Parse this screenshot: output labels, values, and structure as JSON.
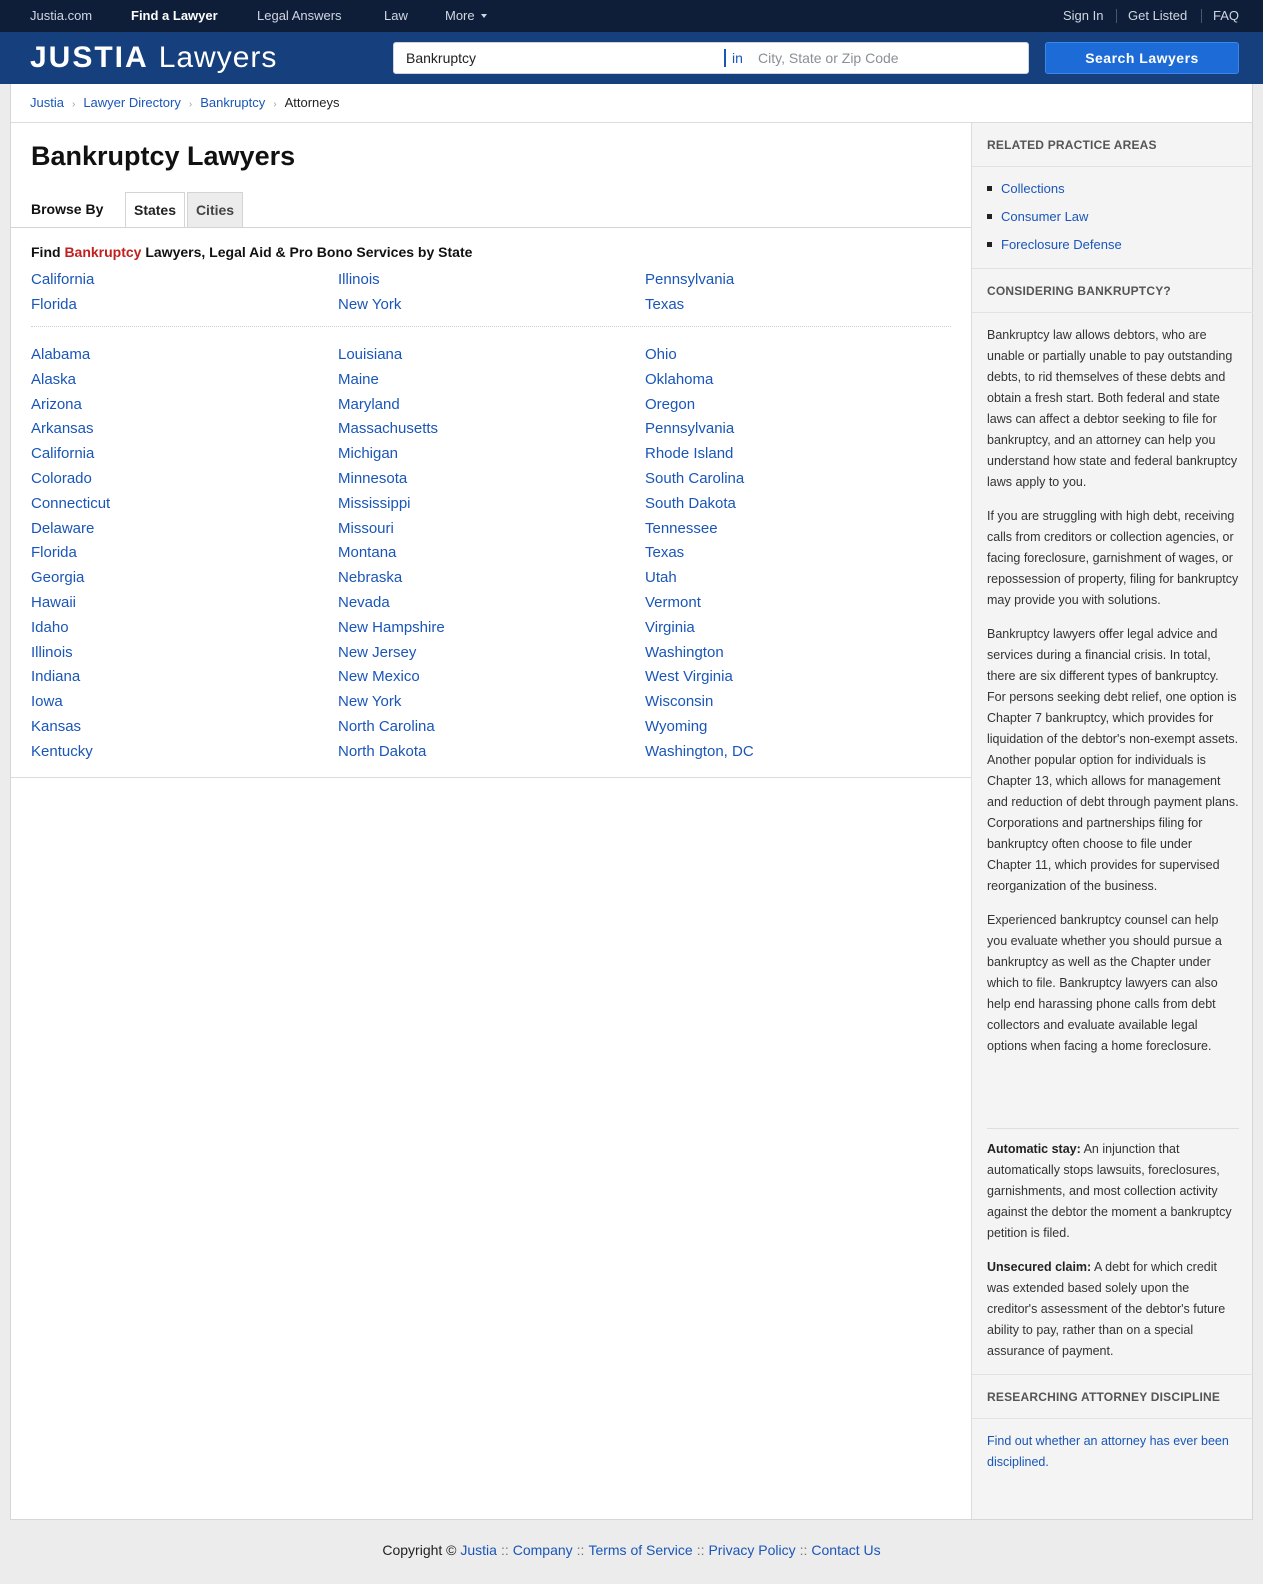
{
  "topnav": {
    "left": [
      {
        "label": "Justia.com"
      },
      {
        "label": "Find a Lawyer"
      },
      {
        "label": "Legal Answers"
      },
      {
        "label": "Law"
      },
      {
        "label": "More"
      }
    ],
    "right": [
      {
        "label": "Sign In"
      },
      {
        "label": "Get Listed"
      },
      {
        "label": "FAQ"
      }
    ]
  },
  "header": {
    "logo_strong": "JUSTIA",
    "logo_light": "Lawyers",
    "search_value": "Bankruptcy",
    "in_label": "in",
    "location_placeholder": "City, State or Zip Code",
    "search_button": "Search Lawyers"
  },
  "breadcrumb": {
    "items": [
      "Justia",
      "Lawyer Directory",
      "Bankruptcy"
    ],
    "current": "Attorneys"
  },
  "main": {
    "title": "Bankruptcy Lawyers",
    "browse_label": "Browse By",
    "tabs": [
      "States",
      "Cities"
    ],
    "find_prefix": "Find",
    "find_highlight": "Bankruptcy",
    "find_suffix": "Lawyers, Legal Aid & Pro Bono Services by State",
    "popular_states": [
      [
        "California",
        "Florida"
      ],
      [
        "Illinois",
        "New York"
      ],
      [
        "Pennsylvania",
        "Texas"
      ]
    ],
    "all_states": [
      [
        "Alabama",
        "Alaska",
        "Arizona",
        "Arkansas",
        "California",
        "Colorado",
        "Connecticut",
        "Delaware",
        "Florida",
        "Georgia",
        "Hawaii",
        "Idaho",
        "Illinois",
        "Indiana",
        "Iowa",
        "Kansas",
        "Kentucky"
      ],
      [
        "Louisiana",
        "Maine",
        "Maryland",
        "Massachusetts",
        "Michigan",
        "Minnesota",
        "Mississippi",
        "Missouri",
        "Montana",
        "Nebraska",
        "Nevada",
        "New Hampshire",
        "New Jersey",
        "New Mexico",
        "New York",
        "North Carolina",
        "North Dakota"
      ],
      [
        "Ohio",
        "Oklahoma",
        "Oregon",
        "Pennsylvania",
        "Rhode Island",
        "South Carolina",
        "South Dakota",
        "Tennessee",
        "Texas",
        "Utah",
        "Vermont",
        "Virginia",
        "Washington",
        "West Virginia",
        "Wisconsin",
        "Wyoming",
        "Washington, DC"
      ]
    ]
  },
  "sidebar": {
    "related_heading": "RELATED PRACTICE AREAS",
    "related_items": [
      "Collections",
      "Consumer Law",
      "Foreclosure Defense"
    ],
    "considering_heading": "CONSIDERING BANKRUPTCY?",
    "paragraphs": [
      "Bankruptcy law allows debtors, who are unable or partially unable to pay outstanding debts, to rid themselves of these debts and obtain a fresh start. Both federal and state laws can affect a debtor seeking to file for bankruptcy, and an attorney can help you understand how state and federal bankruptcy laws apply to you.",
      "If you are struggling with high debt, receiving calls from creditors or collection agencies, or facing foreclosure, garnishment of wages, or repossession of property, filing for bankruptcy may provide you with solutions.",
      "Bankruptcy lawyers offer legal advice and services during a financial crisis. In total, there are six different types of bankruptcy. For persons seeking debt relief, one option is Chapter 7 bankruptcy, which provides for liquidation of the debtor's non-exempt assets. Another popular option for individuals is Chapter 13, which allows for management and reduction of debt through payment plans. Corporations and partnerships filing for bankruptcy often choose to file under Chapter 11, which provides for supervised reorganization of the business.",
      "Experienced bankruptcy counsel can help you evaluate whether you should pursue a bankruptcy as well as the Chapter under which to file. Bankruptcy lawyers can also help end harassing phone calls from debt collectors and evaluate available legal options when facing a home foreclosure."
    ],
    "definitions": [
      {
        "term": "Automatic stay:",
        "text": "An injunction that automatically stops lawsuits, foreclosures, garnishments, and most collection activity against the debtor the moment a bankruptcy petition is filed."
      },
      {
        "term": "Unsecured claim:",
        "text": "A debt for which credit was extended based solely upon the creditor's assessment of the debtor's future ability to pay, rather than on a special assurance of payment."
      }
    ],
    "discipline_heading": "RESEARCHING ATTORNEY DISCIPLINE",
    "discipline_link": "Find out whether an attorney has ever been disciplined."
  },
  "footer": {
    "copyright": "Copyright ©",
    "links": [
      "Justia",
      "Company",
      "Terms of Service",
      "Privacy Policy",
      "Contact Us"
    ],
    "separator": "::"
  }
}
